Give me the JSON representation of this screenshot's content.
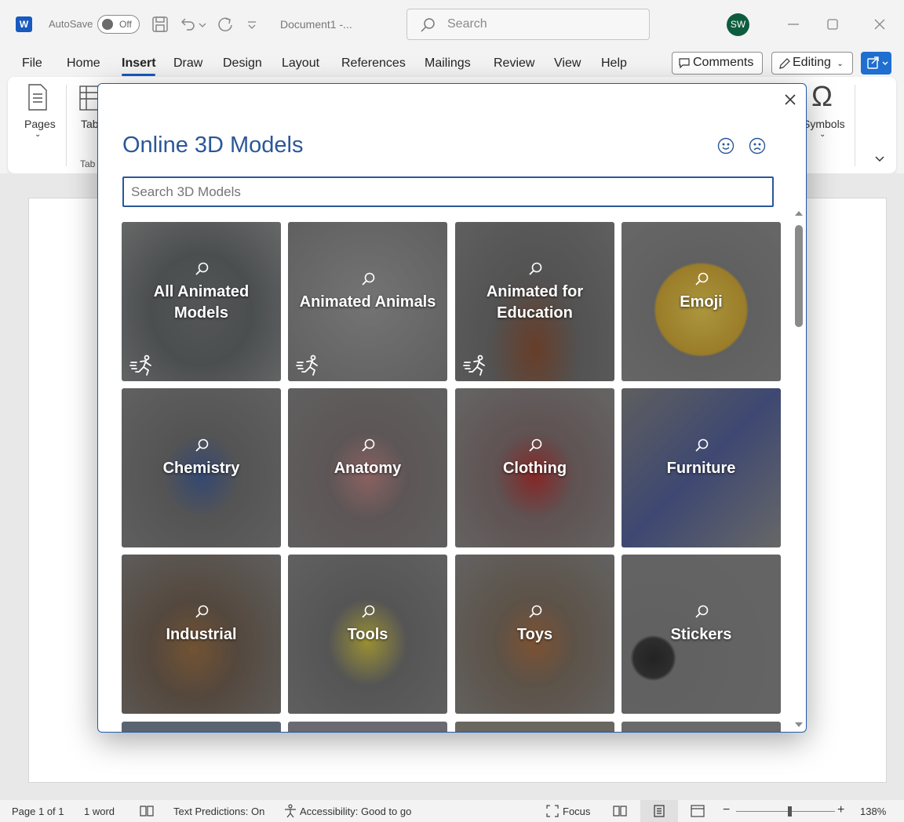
{
  "titlebar": {
    "autosave_label": "AutoSave",
    "autosave_state": "Off",
    "document_title": "Document1  -...",
    "search_placeholder": "Search",
    "avatar_initials": "SW"
  },
  "menu": {
    "tabs": [
      "File",
      "Home",
      "Insert",
      "Draw",
      "Design",
      "Layout",
      "References",
      "Mailings",
      "Review",
      "View",
      "Help"
    ],
    "active_tab": "Insert",
    "comments_label": "Comments",
    "editing_label": "Editing"
  },
  "ribbon": {
    "pages_label": "Pages",
    "table_label": "Tab",
    "tables_group": "Tab",
    "symbols_label": "Symbols"
  },
  "dialog": {
    "title": "Online 3D Models",
    "search_placeholder": "Search 3D Models",
    "tiles": [
      {
        "label_line1": "All Animated",
        "label_line2": "Models",
        "animated": true
      },
      {
        "label_line1": "Animated Animals",
        "label_line2": "",
        "animated": true
      },
      {
        "label_line1": "Animated for",
        "label_line2": "Education",
        "animated": true
      },
      {
        "label_line1": "Emoji",
        "label_line2": "",
        "animated": false
      },
      {
        "label_line1": "Chemistry",
        "label_line2": "",
        "animated": false
      },
      {
        "label_line1": "Anatomy",
        "label_line2": "",
        "animated": false
      },
      {
        "label_line1": "Clothing",
        "label_line2": "",
        "animated": false
      },
      {
        "label_line1": "Furniture",
        "label_line2": "",
        "animated": false
      },
      {
        "label_line1": "Industrial",
        "label_line2": "",
        "animated": false
      },
      {
        "label_line1": "Tools",
        "label_line2": "",
        "animated": false
      },
      {
        "label_line1": "Toys",
        "label_line2": "",
        "animated": false
      },
      {
        "label_line1": "Stickers",
        "label_line2": "",
        "animated": false
      }
    ]
  },
  "statusbar": {
    "page": "Page 1 of 1",
    "words": "1 word",
    "text_predictions": "Text Predictions: On",
    "accessibility": "Accessibility: Good to go",
    "focus": "Focus",
    "zoom": "138%"
  },
  "colors": {
    "accent": "#185abd",
    "dialog_title": "#2b579a",
    "avatar": "#0e5c3e"
  }
}
